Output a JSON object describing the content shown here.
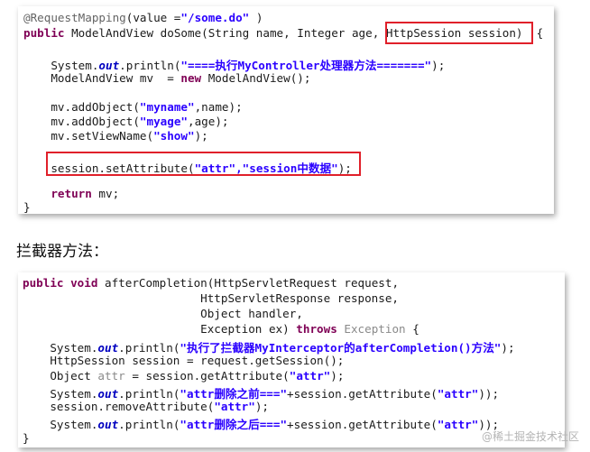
{
  "snippet1": {
    "l1_ann": "@RequestMapping",
    "l1_rest": "(value =",
    "l1_str": "\"/some.do\"",
    "l1_end": " )",
    "l2_kw": "public",
    "l2_rest": " ModelAndView doSome(String name, Integer age, ",
    "l2_param": "HttpSession session)",
    "l2_brace": "  {",
    "l3_a": "    System.",
    "l3_out": "out",
    "l3_b": ".println(",
    "l3_str": "\"====执行MyController处理器方法=======\"",
    "l3_c": ");",
    "l4_a": "    ModelAndView mv  = ",
    "l4_kw": "new",
    "l4_b": " ModelAndView();",
    "l5_a": "    mv.addObject(",
    "l5_str": "\"myname\"",
    "l5_b": ",name);",
    "l6_a": "    mv.addObject(",
    "l6_str": "\"myage\"",
    "l6_b": ",age);",
    "l7_a": "    mv.setViewName(",
    "l7_str": "\"show\"",
    "l7_b": ");",
    "l8_a": "    session.setAttribute(",
    "l8_str1": "\"attr\"",
    "l8_comma": ",",
    "l8_str2": "\"session中数据\"",
    "l8_b": ");",
    "l9_kw": "    return",
    "l9_b": " mv;",
    "l10": "}"
  },
  "heading": "拦截器方法：",
  "snippet2": {
    "l1_kw1": "public",
    "l1_kw2": "void",
    "l1_rest": " afterCompletion(HttpServletRequest request,",
    "l2": "                          HttpServletResponse response,",
    "l3": "                          Object handler,",
    "l4_a": "                          Exception ex) ",
    "l4_kw": "throws",
    "l4_gray": " Exception",
    "l4_b": " {",
    "l5_a": "    System.",
    "l5_out": "out",
    "l5_b": ".println(",
    "l5_str": "\"执行了拦截器MyInterceptor的afterCompletion()方法\"",
    "l5_c": ");",
    "l6": "    HttpSession session = request.getSession();",
    "l7_a": "    Object ",
    "l7_gray": "attr",
    "l7_b": " = session.getAttribute(",
    "l7_str": "\"attr\"",
    "l7_c": ");",
    "l8_a": "    System.",
    "l8_out": "out",
    "l8_b": ".println(",
    "l8_str": "\"attr删除之前===\"",
    "l8_c": "+session.getAttribute(",
    "l8_str2": "\"attr\"",
    "l8_d": "));",
    "l9_a": "    session.removeAttribute(",
    "l9_str": "\"attr\"",
    "l9_b": ");",
    "l10_a": "    System.",
    "l10_out": "out",
    "l10_b": ".println(",
    "l10_str": "\"attr删除之后===\"",
    "l10_c": "+session.getAttribute(",
    "l10_str2": "\"attr\"",
    "l10_d": "));",
    "l11": "}"
  },
  "watermark": "@稀土掘金技术社区",
  "colors": {
    "keyword": "#7f0055",
    "string": "#2a00ff",
    "static_field": "#0000c0",
    "annotation": "#646464",
    "highlight_border": "#e0202a"
  }
}
